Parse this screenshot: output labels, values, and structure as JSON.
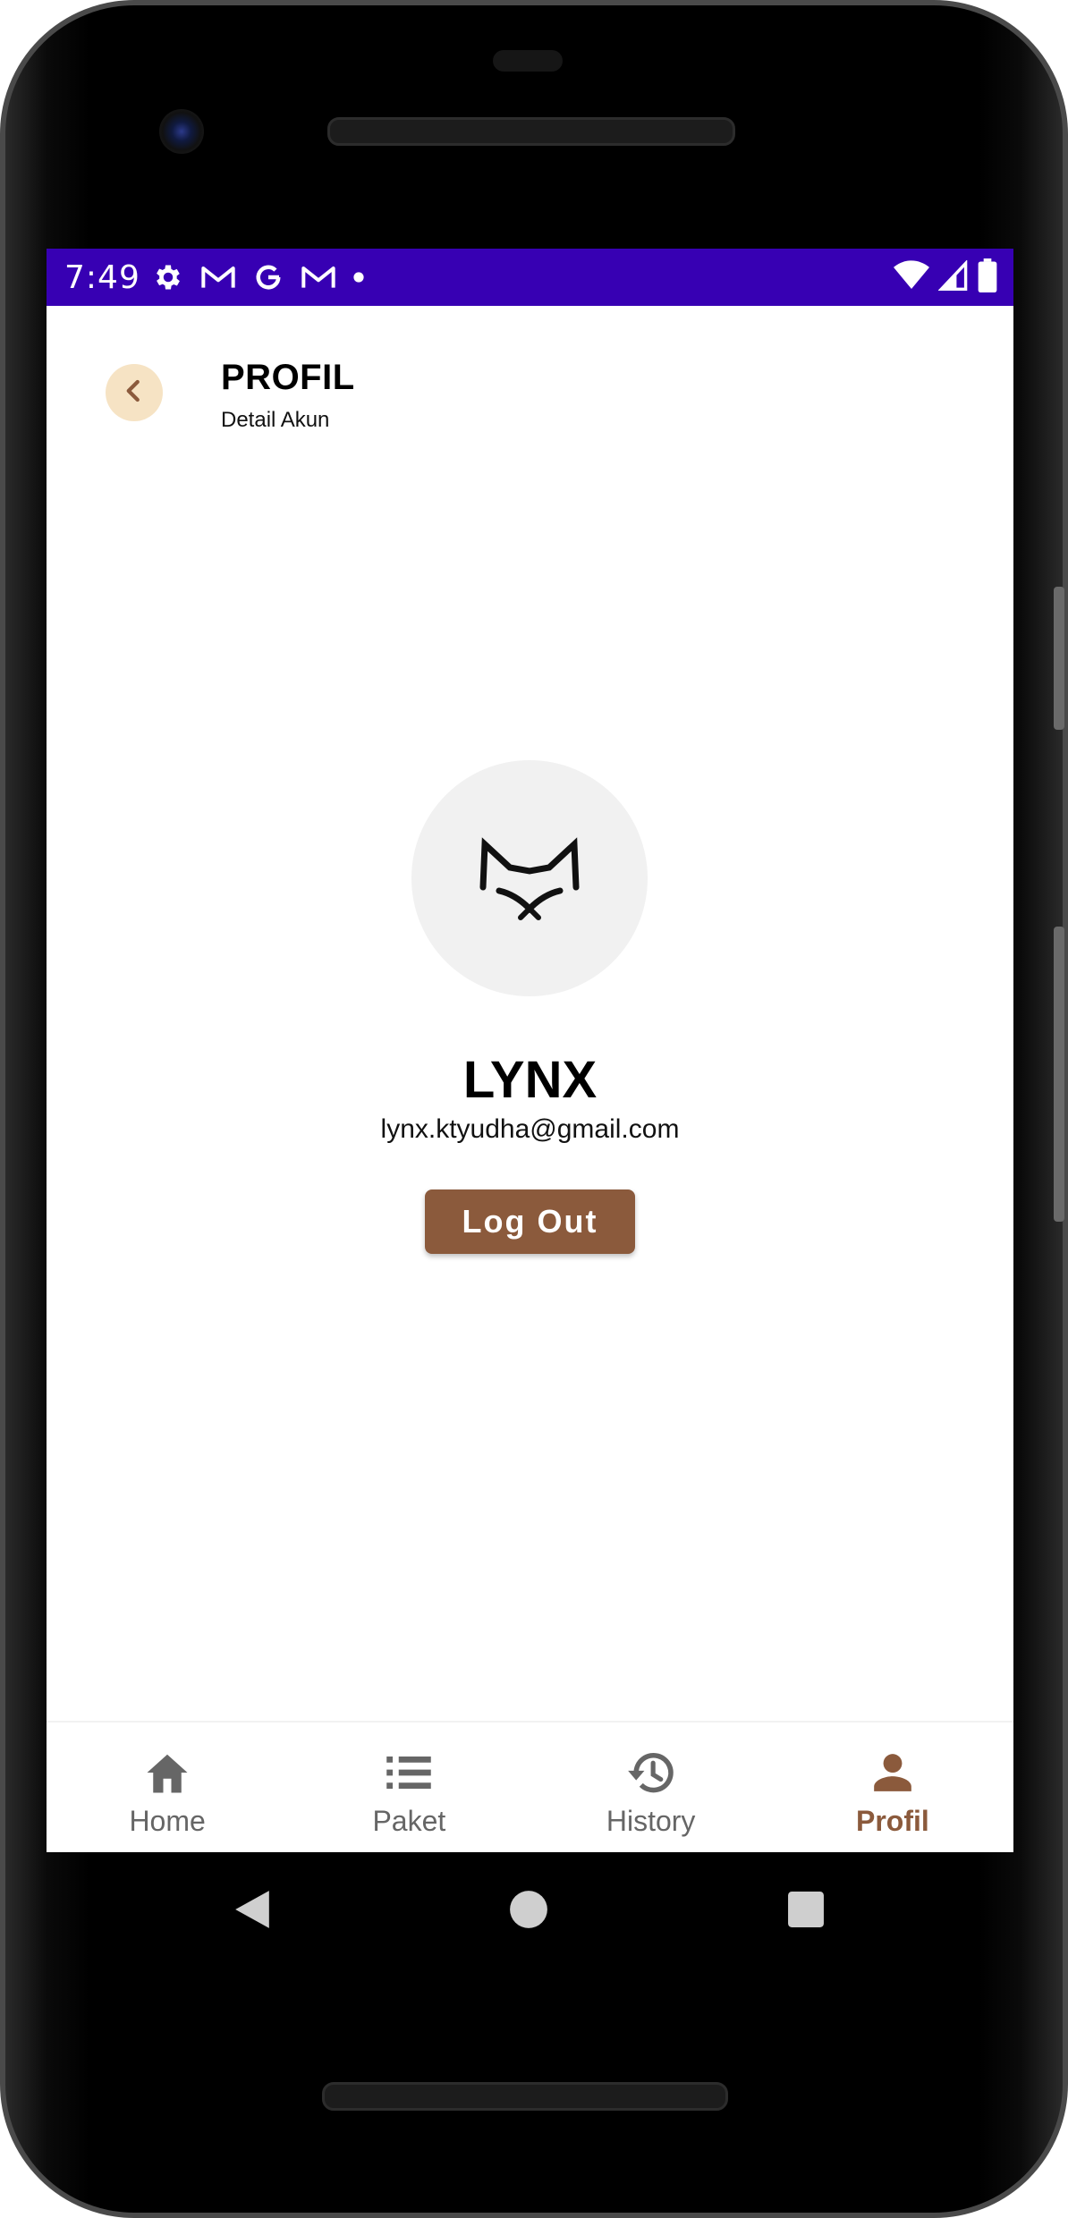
{
  "status_bar": {
    "time": "7:49",
    "background": "#3700b3",
    "left_icons": [
      "gear-icon",
      "gmail-icon",
      "google-icon",
      "gmail-icon",
      "dot-icon"
    ],
    "right_icons": [
      "wifi-icon",
      "signal-icon",
      "battery-icon"
    ]
  },
  "header": {
    "title": "PROFIL",
    "subtitle": "Detail Akun",
    "back_icon": "chevron-left-icon"
  },
  "profile": {
    "avatar_icon": "lynx-logo-icon",
    "name": "LYNX",
    "email": "lynx.ktyudha@gmail.com",
    "logout_label": "Log Out"
  },
  "bottom_nav": {
    "items": [
      {
        "label": "Home",
        "icon": "home-icon",
        "active": false
      },
      {
        "label": "Paket",
        "icon": "list-icon",
        "active": false
      },
      {
        "label": "History",
        "icon": "history-icon",
        "active": false
      },
      {
        "label": "Profil",
        "icon": "person-icon",
        "active": true
      }
    ]
  },
  "android_nav": {
    "icons": [
      "back-triangle-icon",
      "home-circle-icon",
      "recents-square-icon"
    ]
  },
  "colors": {
    "accent": "#8b5a3c",
    "back_button_bg": "#f6e3c4",
    "avatar_bg": "#f1f1f1",
    "nav_inactive": "#666666"
  }
}
